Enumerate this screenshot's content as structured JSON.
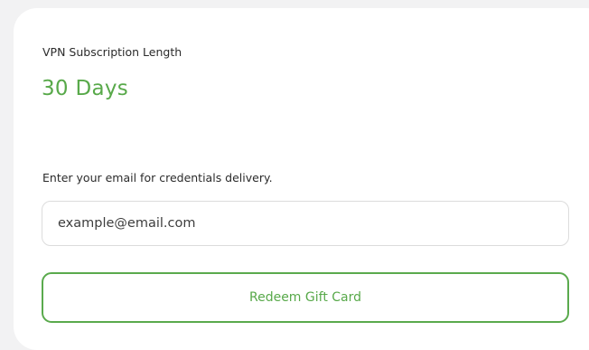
{
  "subscription": {
    "label": "VPN Subscription Length",
    "value": "30 Days"
  },
  "email": {
    "label": "Enter your email for credentials delivery.",
    "placeholder": "example@email.com",
    "value": ""
  },
  "actions": {
    "redeem_label": "Redeem Gift Card"
  },
  "colors": {
    "accent": "#58a94a",
    "background": "#f2f2f3",
    "card": "#ffffff",
    "input_border": "#dcdcdc"
  }
}
